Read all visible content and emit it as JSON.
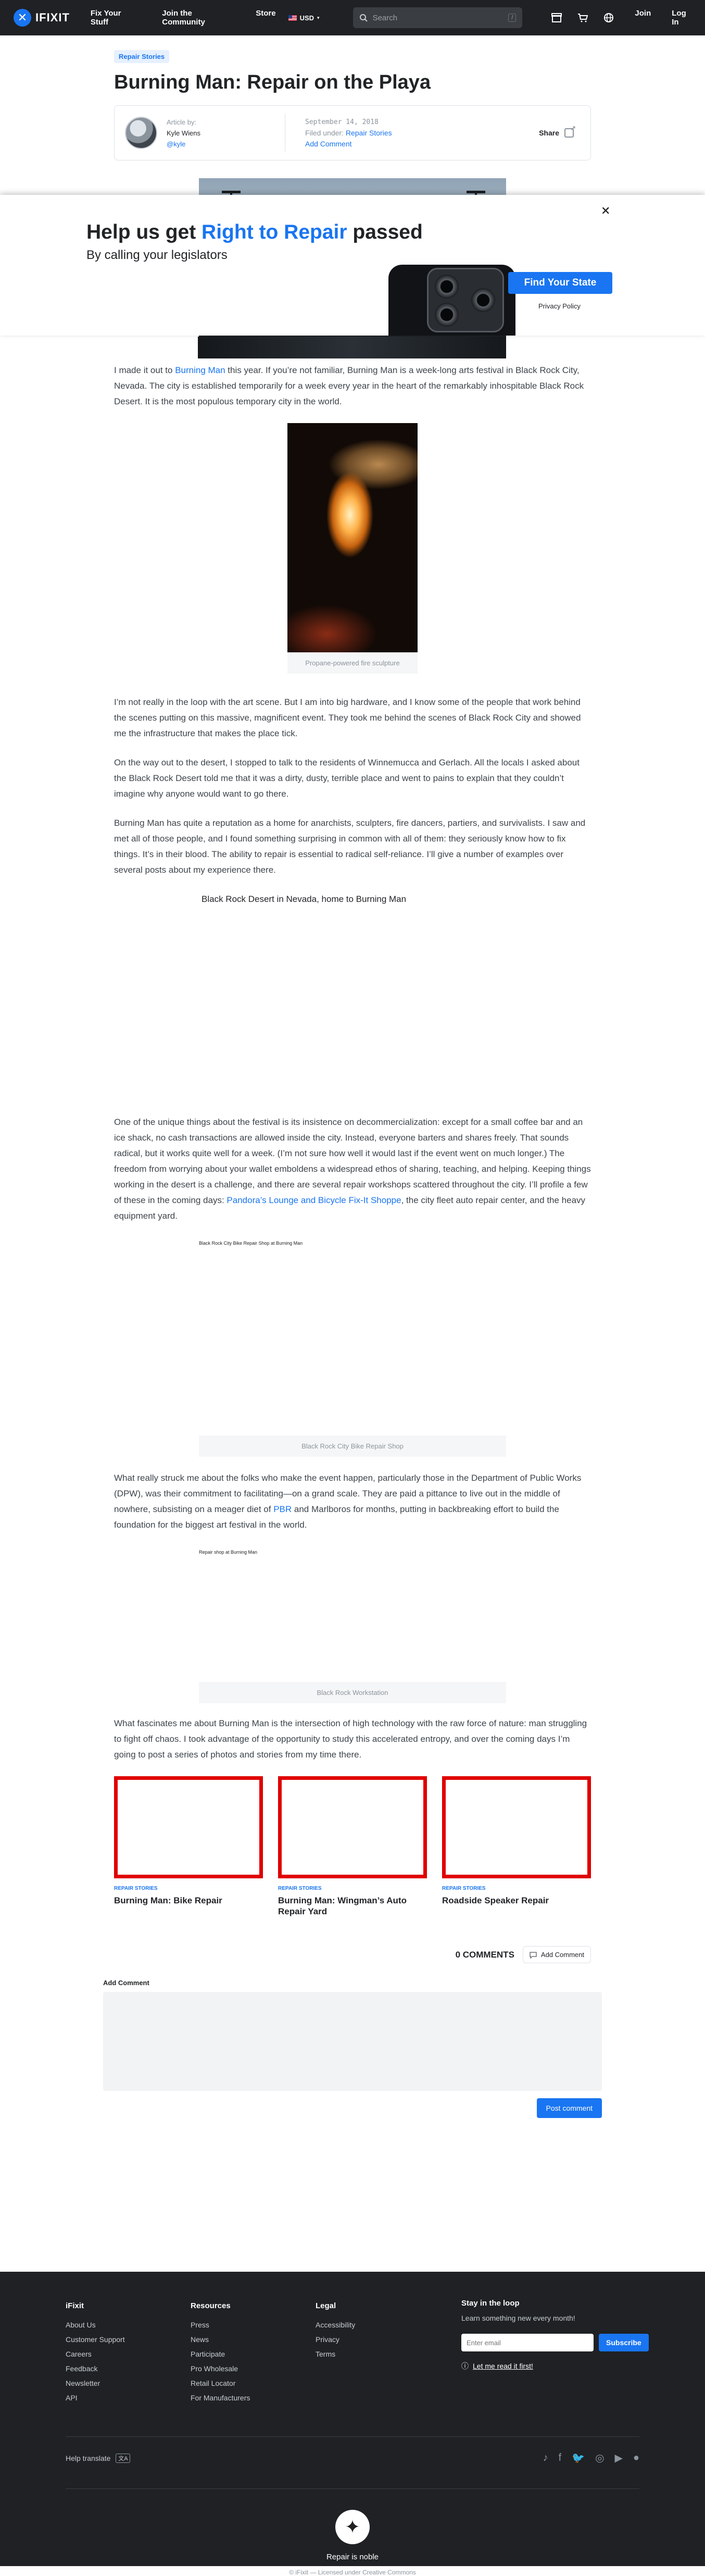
{
  "nav": {
    "logo": "IFIXIT",
    "links": [
      "Fix Your Stuff",
      "Join the Community",
      "Store"
    ],
    "currency": "USD",
    "search_placeholder": "Search",
    "search_shortcut": "/",
    "join": "Join",
    "login": "Log In"
  },
  "article": {
    "tag": "Repair Stories",
    "title": "Burning Man: Repair on the Playa",
    "author_label": "Article by:",
    "author_name": "Kyle Wiens",
    "author_handle": "@kyle",
    "date": "September 14, 2018",
    "filed_label": "Filed under:",
    "filed_value": "Repair Stories",
    "add_comment": "Add Comment",
    "share": "Share"
  },
  "banner": {
    "headline_pre": "Help us get ",
    "headline_highlight": "Right to Repair",
    "headline_post": " passed",
    "sub": "By calling your legislators",
    "cta": "Find Your State",
    "privacy": "Privacy Policy",
    "close": "✕"
  },
  "body": {
    "p1_pre": "I made it out to ",
    "p1_link": "Burning Man",
    "p1_post": " this year. If you’re not familiar, Burning Man is a week-long arts festival in Black Rock City, Nevada. The city is established temporarily for a week every year in the heart of the remarkably inhospitable Black Rock Desert. It is the most populous temporary city in the world.",
    "fig1_caption": "Propane-powered fire sculpture",
    "p2": "I’m not really in the loop with the art scene. But I am into big hardware, and I know some of the people that work behind the scenes putting on this massive, magnificent event. They took me behind the scenes of Black Rock City and showed me the infrastructure that makes the place tick.",
    "p3": "On the way out to the desert, I stopped to talk to the residents of Winnemucca and Gerlach. All the locals I asked about the Black Rock Desert told me that it was a dirty, dusty, terrible place and went to pains to explain that they couldn’t imagine why anyone would want to go there.",
    "p4": "Burning Man has quite a reputation as a home for anarchists, sculpters, fire dancers, partiers, and survivalists. I saw and met all of those people, and I found something surprising in common with all of them: they seriously know how to fix things. It’s in their blood. The ability to repair is essential to radical self-reliance. I’ll give a number of examples over several posts about my experience there.",
    "map_title": "Black Rock Desert in Nevada, home to Burning Man",
    "p5_pre": "One of the unique things about the festival is its insistence on decommercialization: except for a small coffee bar and an ice shack, no cash transactions are allowed inside the city. Instead, everyone barters and shares freely. That sounds radical, but it works quite well for a week. (I’m not sure how well it would last if the event went on much longer.) The freedom from worrying about your wallet emboldens a widespread ethos of sharing, teaching, and helping. Keeping things working in the desert is a challenge, and there are several repair workshops scattered throughout the city. I’ll profile a few of these in the coming days: ",
    "p5_link": "Pandora’s Lounge and Bicycle Fix-It Shoppe",
    "p5_post": ", the city fleet auto repair center, and the heavy equipment yard.",
    "gallery1_label": "Black Rock City Bike Repair Shop at Burning Man",
    "gallery1_caption": "Black Rock City Bike Repair Shop",
    "p6_pre": "What really struck me about the folks who make the event happen, particularly those in the Department of Public Works (DPW), was their commitment to facilitating—on a grand scale. They are paid a pittance to live out in the middle of nowhere, subsisting on a meager diet of ",
    "p6_link": "PBR",
    "p6_post": " and Marlboros for months, putting in backbreaking effort to build the foundation for the biggest art festival in the world.",
    "gallery2_label": "Repair shop at Burning Man",
    "gallery2_caption": "Black Rock Workstation",
    "p7": "What fascinates me about Burning Man is the intersection of high technology with the raw force of nature: man struggling to fight off chaos. I took advantage of the opportunity to study this accelerated entropy, and over the coming days I’m going to post a series of photos and stories from my time there."
  },
  "related": [
    {
      "tag": "REPAIR STORIES",
      "title": "Burning Man: Bike Repair"
    },
    {
      "tag": "REPAIR STORIES",
      "title": "Burning Man: Wingman’s Auto Repair Yard"
    },
    {
      "tag": "REPAIR STORIES",
      "title": "Roadside Speaker Repair"
    }
  ],
  "comments": {
    "count": "0 COMMENTS",
    "add": "Add Comment",
    "form_label": "Add Comment",
    "post": "Post comment"
  },
  "footer": {
    "col1_title": "iFixit",
    "col1": [
      "About Us",
      "Customer Support",
      "Careers",
      "Feedback",
      "Newsletter",
      "API"
    ],
    "col2_title": "Resources",
    "col2": [
      "Press",
      "News",
      "Participate",
      "Pro Wholesale",
      "Retail Locator",
      "For Manufacturers"
    ],
    "col3_title": "Legal",
    "col3": [
      "Accessibility",
      "Privacy",
      "Terms"
    ],
    "news_title": "Stay in the loop",
    "news_text": "Learn something new every month!",
    "news_placeholder": "Enter email",
    "news_button": "Subscribe",
    "news_first": "Let me read it first!",
    "help_translate": "Help translate",
    "tagline": "Repair is noble",
    "license": "© iFixit — Licensed under Creative Commons"
  },
  "colors": {
    "accent": "#1975f1",
    "nav_bg": "#1f2124",
    "card_border": "#e00000"
  }
}
